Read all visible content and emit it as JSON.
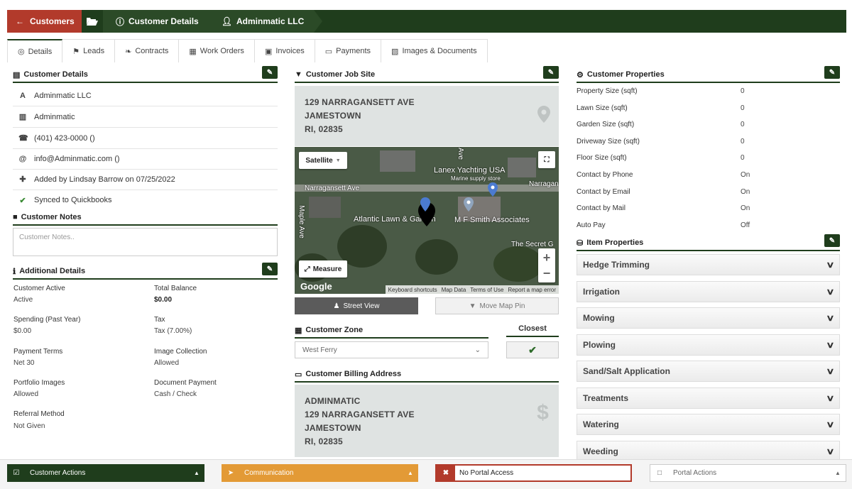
{
  "breadcrumb": {
    "back_label": "Customers",
    "item1": "Customer Details",
    "item2": "Adminmatic LLC"
  },
  "tabs": [
    "Details",
    "Leads",
    "Contracts",
    "Work Orders",
    "Invoices",
    "Payments",
    "Images & Documents"
  ],
  "customer_details": {
    "title": "Customer Details",
    "company": "Adminmatic LLC",
    "name": "Adminmatic",
    "phone": "(401) 423-0000 ()",
    "email": "info@Adminmatic.com ()",
    "added_by": "Added by Lindsay Barrow on 07/25/2022",
    "synced": "Synced to Quickbooks"
  },
  "customer_notes": {
    "title": "Customer Notes",
    "placeholder": "Customer Notes.."
  },
  "additional_details": {
    "title": "Additional Details",
    "customer_active_label": "Customer Active",
    "customer_active": "Active",
    "total_balance_label": "Total Balance",
    "total_balance": "$0.00",
    "spending_label": "Spending (Past Year)",
    "spending": "$0.00",
    "tax_label": "Tax",
    "tax": "Tax (7.00%)",
    "payment_terms_label": "Payment Terms",
    "payment_terms": "Net 30",
    "image_collection_label": "Image Collection",
    "image_collection": "Allowed",
    "portfolio_images_label": "Portfolio Images",
    "portfolio_images": "Allowed",
    "document_payment_label": "Document Payment",
    "document_payment": "Cash / Check",
    "referral_method_label": "Referral Method",
    "referral_method": "Not Given"
  },
  "job_site": {
    "title": "Customer Job Site",
    "line1": "129 NARRAGANSETT AVE",
    "line2": "JAMESTOWN",
    "line3": "RI, 02835"
  },
  "map": {
    "satellite_label": "Satellite",
    "measure_label": "Measure",
    "labels": [
      "Narragansett Ave",
      "Lanex Yachting USA",
      "Marine supply store",
      "Atlantic Lawn & Garden",
      "M F Smith Associates",
      "The Secret G",
      "Narragan",
      "Maple Ave",
      "Ave"
    ],
    "google": "Google",
    "footer": [
      "Keyboard shortcuts",
      "Map Data",
      "Terms of Use",
      "Report a map error"
    ],
    "street_view_label": "Street View",
    "move_pin_label": "Move Map Pin"
  },
  "zone": {
    "title": "Customer Zone",
    "selected": "West Ferry",
    "closest_label": "Closest"
  },
  "billing": {
    "title": "Customer Billing Address",
    "line1": "ADMINMATIC",
    "line2": "129 NARRAGANSETT AVE",
    "line3": "JAMESTOWN",
    "line4": "RI, 02835"
  },
  "properties": {
    "title": "Customer Properties",
    "items": [
      {
        "label": "Property Size (sqft)",
        "value": "0"
      },
      {
        "label": "Lawn Size (sqft)",
        "value": "0"
      },
      {
        "label": "Garden Size (sqft)",
        "value": "0"
      },
      {
        "label": "Driveway Size (sqft)",
        "value": "0"
      },
      {
        "label": "Floor Size (sqft)",
        "value": "0"
      },
      {
        "label": "Contact by Phone",
        "value": "On"
      },
      {
        "label": "Contact by Email",
        "value": "On"
      },
      {
        "label": "Contact by Mail",
        "value": "On"
      },
      {
        "label": "Auto Pay",
        "value": "Off"
      }
    ]
  },
  "item_properties": {
    "title": "Item Properties",
    "items": [
      "Hedge Trimming",
      "Irrigation",
      "Mowing",
      "Plowing",
      "Sand/Salt Application",
      "Treatments",
      "Watering",
      "Weeding"
    ]
  },
  "bottom_bar": {
    "customer_actions": "Customer Actions",
    "communication": "Communication",
    "portal_access": "No Portal Access",
    "portal_actions": "Portal Actions"
  },
  "colors": {
    "dark_green": "#1f3d1c",
    "red": "#b23a2b",
    "orange": "#e39a36"
  }
}
